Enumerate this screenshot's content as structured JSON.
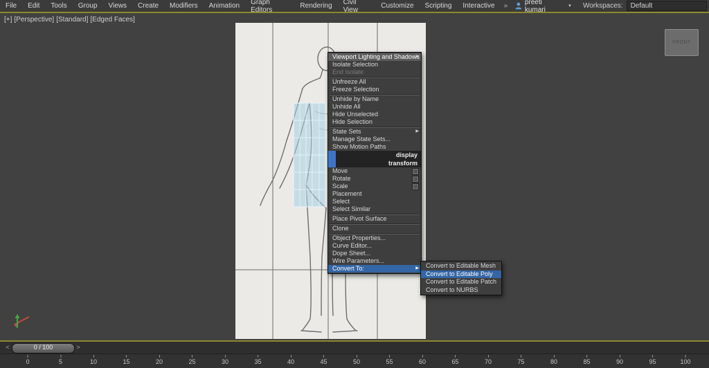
{
  "menubar": {
    "items": [
      "File",
      "Edit",
      "Tools",
      "Group",
      "Views",
      "Create",
      "Modifiers",
      "Animation",
      "Graph Editors",
      "Rendering",
      "Civil View",
      "Customize",
      "Scripting",
      "Interactive"
    ],
    "user_name": "preeti kumari",
    "workspaces_label": "Workspaces:",
    "workspace_value": "Default"
  },
  "icons": {
    "submenu_arrow": "▶",
    "dropdown_caret": "▼",
    "overflow_chevron": "»",
    "prev_frame": "<",
    "next_frame": ">"
  },
  "viewport": {
    "segments": [
      "[+]",
      "[Perspective]",
      "[Standard]",
      "[Edged Faces]"
    ],
    "viewcube_label": "FRONT"
  },
  "context_menu": {
    "items": [
      {
        "label": "Viewport Lighting and Shadows",
        "state": "hover",
        "arrow": true
      },
      {
        "label": "Isolate Selection"
      },
      {
        "label": "End Isolate",
        "state": "disabled"
      },
      {
        "type": "separator"
      },
      {
        "label": "Unfreeze All"
      },
      {
        "label": "Freeze Selection"
      },
      {
        "type": "separator"
      },
      {
        "label": "Unhide by Name"
      },
      {
        "label": "Unhide All"
      },
      {
        "label": "Hide Unselected"
      },
      {
        "label": "Hide Selection"
      },
      {
        "type": "separator"
      },
      {
        "label": "State Sets",
        "arrow": true
      },
      {
        "label": "Manage State Sets..."
      },
      {
        "label": "Show Motion Paths"
      },
      {
        "type": "header",
        "label": "display"
      },
      {
        "type": "header",
        "label": "transform"
      },
      {
        "label": "Move",
        "icon": true
      },
      {
        "label": "Rotate",
        "icon": true
      },
      {
        "label": "Scale",
        "icon": true
      },
      {
        "label": "Placement"
      },
      {
        "label": "Select"
      },
      {
        "label": "Select Similar"
      },
      {
        "type": "separator"
      },
      {
        "label": "Place Pivot Surface"
      },
      {
        "type": "separator"
      },
      {
        "label": "Clone"
      },
      {
        "type": "separator"
      },
      {
        "label": "Object Properties..."
      },
      {
        "label": "Curve Editor..."
      },
      {
        "label": "Dope Sheet..."
      },
      {
        "label": "Wire Parameters..."
      },
      {
        "label": "Convert To:",
        "state": "selected",
        "arrow": true
      }
    ]
  },
  "submenu": {
    "items": [
      {
        "label": "Convert to Editable Mesh"
      },
      {
        "label": "Convert to Editable Poly",
        "state": "selected"
      },
      {
        "label": "Convert to Editable Patch"
      },
      {
        "label": "Convert to NURBS"
      }
    ]
  },
  "timeline": {
    "slider_label": "0 / 100",
    "ticks": [
      0,
      5,
      10,
      15,
      20,
      25,
      30,
      35,
      40,
      45,
      50,
      55,
      60,
      65,
      70,
      75,
      80,
      85,
      90,
      95,
      100
    ]
  }
}
